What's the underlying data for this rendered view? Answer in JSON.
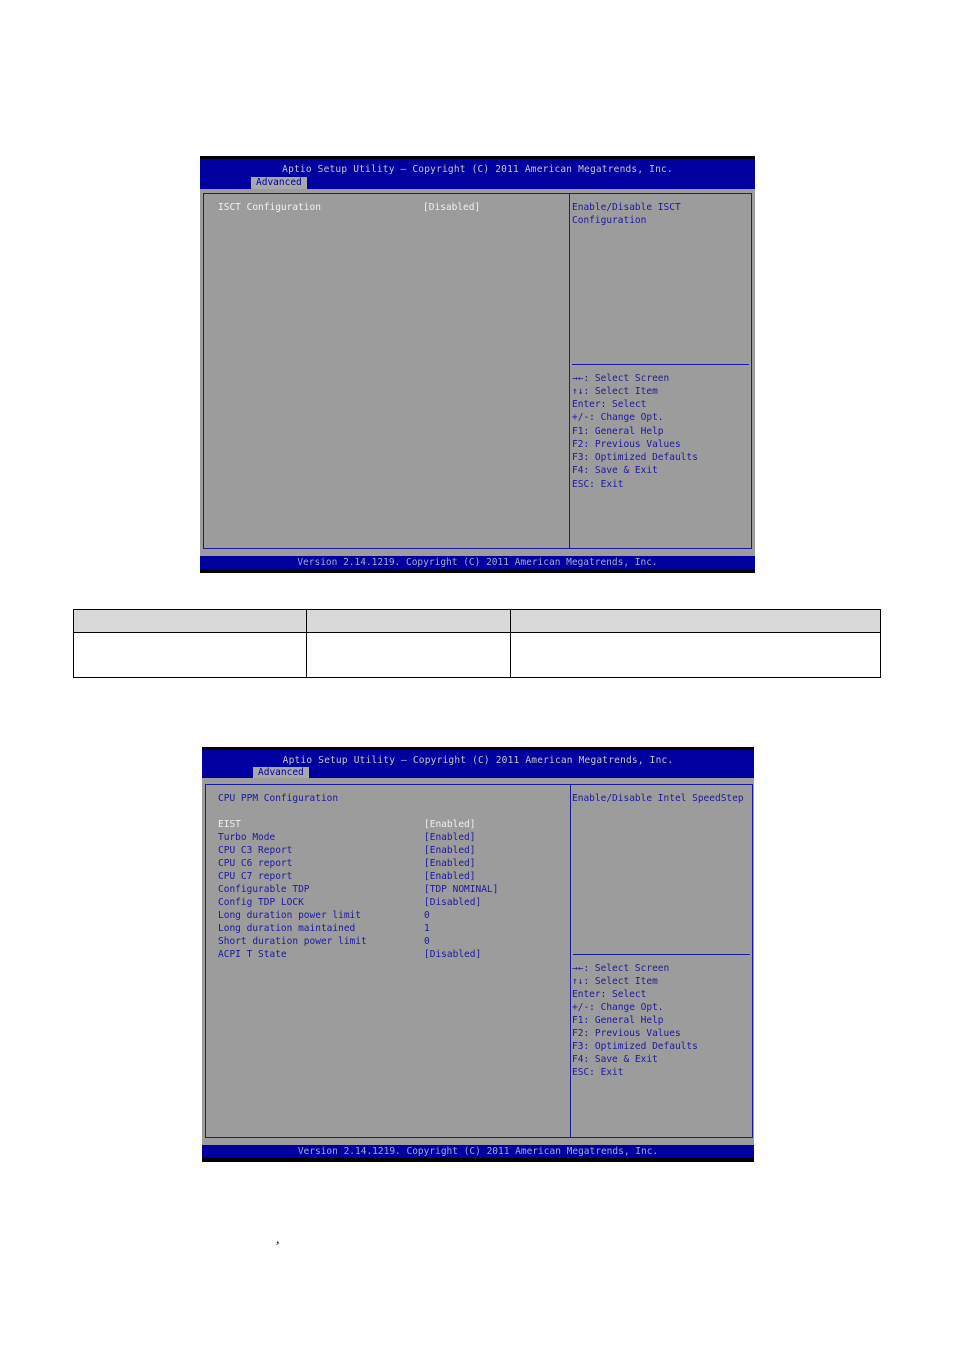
{
  "screen1": {
    "title": "Aptio Setup Utility – Copyright (C) 2011 American Megatrends, Inc.",
    "tab": "Advanced",
    "items": [
      {
        "label": "ISCT Configuration",
        "value": "[Disabled]",
        "selected": true
      }
    ],
    "help": [
      "Enable/Disable ISCT",
      "Configuration"
    ],
    "keys": [
      "→←: Select Screen",
      "↑↓: Select Item",
      "Enter: Select",
      "+/-: Change Opt.",
      "F1: General Help",
      "F2: Previous Values",
      "F3: Optimized Defaults",
      "F4: Save & Exit",
      "ESC: Exit"
    ],
    "footer": "Version 2.14.1219. Copyright (C) 2011 American Megatrends, Inc."
  },
  "table": {
    "headers": [
      "",
      "",
      ""
    ],
    "rows": [
      [
        "",
        "",
        ""
      ]
    ]
  },
  "screen2": {
    "title": "Aptio Setup Utility – Copyright (C) 2011 American Megatrends, Inc.",
    "tab": "Advanced",
    "section": "CPU PPM Configuration",
    "items": [
      {
        "label": "EIST",
        "value": "[Enabled]",
        "selected": true
      },
      {
        "label": "Turbo Mode",
        "value": "[Enabled]"
      },
      {
        "label": "CPU C3 Report",
        "value": "[Enabled]"
      },
      {
        "label": "CPU C6 report",
        "value": "[Enabled]"
      },
      {
        "label": "CPU C7 report",
        "value": "[Enabled]"
      },
      {
        "label": "Configurable TDP",
        "value": "[TDP NOMINAL]"
      },
      {
        "label": "Config TDP LOCK",
        "value": "[Disabled]"
      },
      {
        "label": "Long duration power limit",
        "value": "0"
      },
      {
        "label": "Long duration maintained",
        "value": "1"
      },
      {
        "label": "Short duration power limit",
        "value": "0"
      },
      {
        "label": "ACPI T State",
        "value": "[Disabled]"
      }
    ],
    "help": [
      "Enable/Disable Intel SpeedStep"
    ],
    "keys": [
      "→←: Select Screen",
      "↑↓: Select Item",
      "Enter: Select",
      "+/-: Change Opt.",
      "F1: General Help",
      "F2: Previous Values",
      "F3: Optimized Defaults",
      "F4: Save & Exit",
      "ESC: Exit"
    ],
    "footer": "Version 2.14.1219. Copyright (C) 2011 American Megatrends, Inc."
  },
  "stray_text": ","
}
